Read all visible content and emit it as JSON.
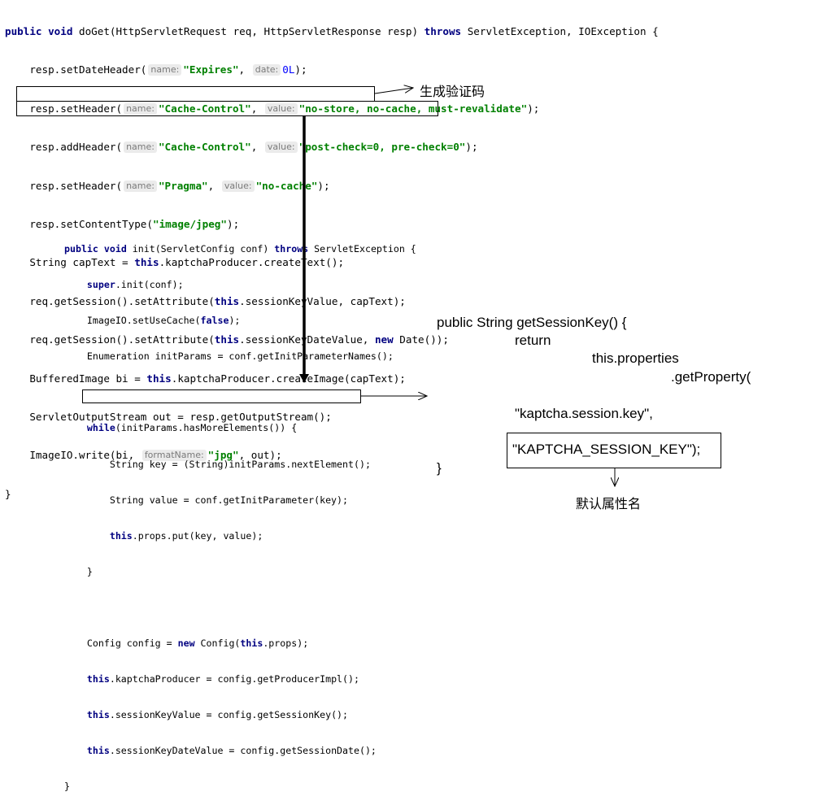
{
  "code_doget": {
    "l1": {
      "kw1": "public",
      "kw2": "void",
      "t1": " doGet(HttpServletRequest req, HttpServletResponse resp) ",
      "kw3": "throws",
      "t2": " ServletException, IOException {"
    },
    "l2": {
      "t1": "    resp.setDateHeader(",
      "h1": "name:",
      "s1": "\"Expires\"",
      "t2": ", ",
      "h2": "date:",
      "n1": "0L",
      "t3": ");"
    },
    "l3": {
      "t1": "    resp.setHeader(",
      "h1": "name:",
      "s1": "\"Cache-Control\"",
      "t2": ", ",
      "h2": "value:",
      "s2": "\"no-store, no-cache, must-revalidate\"",
      "t3": ");"
    },
    "l4": {
      "t1": "    resp.addHeader(",
      "h1": "name:",
      "s1": "\"Cache-Control\"",
      "t2": ", ",
      "h2": "value:",
      "s2": "\"post-check=0, pre-check=0\"",
      "t3": ");"
    },
    "l5": {
      "t1": "    resp.setHeader(",
      "h1": "name:",
      "s1": "\"Pragma\"",
      "t2": ", ",
      "h2": "value:",
      "s2": "\"no-cache\"",
      "t3": ");"
    },
    "l6": {
      "t1": "    resp.setContentType(",
      "s1": "\"image/jpeg\"",
      "t2": ");"
    },
    "l7": {
      "t1": "    String capText = ",
      "kw1": "this",
      "t2": ".kaptchaProducer.createText();"
    },
    "l8": {
      "t1": "    req.getSession().setAttribute(",
      "kw1": "this",
      "t2": ".sessionKeyValue, capText);"
    },
    "l9": {
      "t1": "    req.getSession().setAttribute(",
      "kw1": "this",
      "t2": ".sessionKeyDateValue, ",
      "kw2": "new",
      "t3": " Date());"
    },
    "l10": {
      "t1": "    BufferedImage bi = ",
      "kw1": "this",
      "t2": ".kaptchaProducer.createImage(capText);"
    },
    "l11": {
      "t1": "    ServletOutputStream out = resp.getOutputStream();"
    },
    "l12": {
      "t1": "    ImageIO.write(bi, ",
      "h1": "formatName:",
      "s1": "\"jpg\"",
      "t2": ", out);"
    },
    "l13": {
      "t1": "}"
    }
  },
  "code_init": {
    "l1": {
      "kw1": "public",
      "kw2": "void",
      "t1": " init(ServletConfig conf) ",
      "kw3": "throws",
      "t2": " ServletException {"
    },
    "l2": {
      "t1": "    ",
      "kw1": "super",
      "t2": ".init(conf);"
    },
    "l3": {
      "t1": "    ImageIO.setUseCache(",
      "kw1": "false",
      "t2": ");"
    },
    "l4": {
      "t1": "    Enumeration initParams = conf.getInitParameterNames();"
    },
    "l5": {
      "t1": ""
    },
    "l6": {
      "t1": "    ",
      "kw1": "while",
      "t2": "(initParams.hasMoreElements()) {"
    },
    "l7": {
      "t1": "        String key = (String)initParams.nextElement();"
    },
    "l8": {
      "t1": "        String value = conf.getInitParameter(key);"
    },
    "l9": {
      "t1": "        ",
      "kw1": "this",
      "t2": ".props.put(key, value);"
    },
    "l10": {
      "t1": "    }"
    },
    "l11": {
      "t1": ""
    },
    "l12": {
      "t1": "    Config config = ",
      "kw1": "new",
      "t2": " Config(",
      "kw2": "this",
      "t3": ".props);"
    },
    "l13": {
      "t1": "    ",
      "kw1": "this",
      "t2": ".kaptchaProducer = config.getProducerImpl();"
    },
    "l14": {
      "t1": "    ",
      "kw1": "this",
      "t2": ".sessionKeyValue = config.getSessionKey();"
    },
    "l15": {
      "t1": "    ",
      "kw1": "this",
      "t2": ".sessionKeyDateValue = config.getSessionDate();"
    },
    "l16": {
      "t1": "}"
    }
  },
  "annotations": {
    "generate_captcha": "生成验证码",
    "default_attribute_name": "默认属性名"
  },
  "getsessionkey": {
    "line1": "public String getSessionKey() {",
    "line2": "return",
    "line3": "this.properties",
    "line4": ".getProperty(",
    "line5": "\"kaptcha.session.key\",",
    "line6": "\"KAPTCHA_SESSION_KEY\");",
    "line7": "}"
  }
}
